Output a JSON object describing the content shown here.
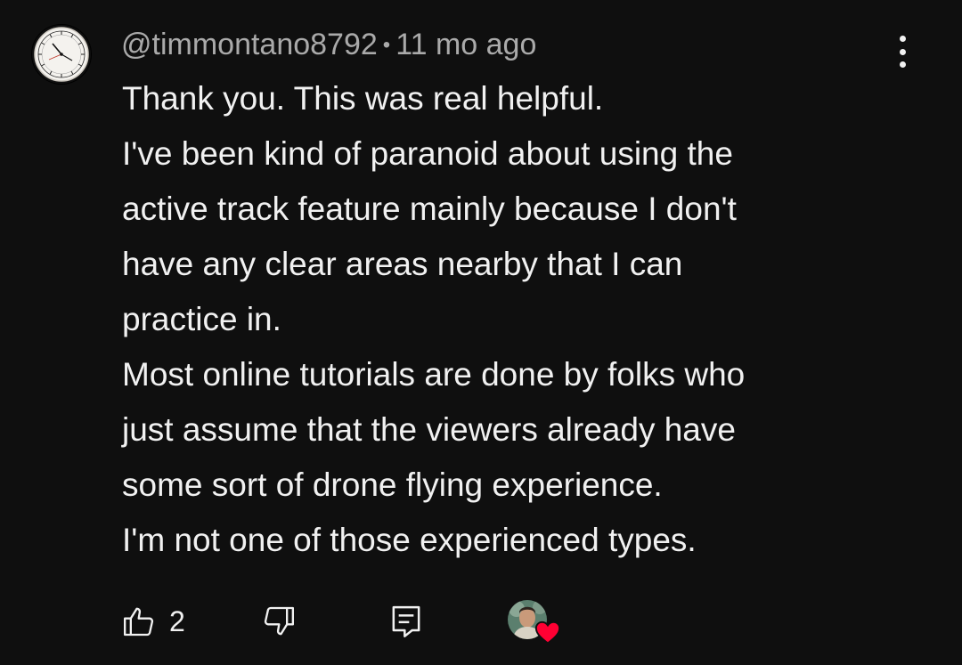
{
  "comment": {
    "username": "@timmontano8792",
    "separator": "•",
    "timestamp": "11 mo ago",
    "lines": [
      "Thank you.  This was real helpful.",
      "I've been kind of paranoid about using the",
      "active track feature mainly because I don't",
      "have any clear areas nearby that I can",
      "practice in.",
      "Most online tutorials are done by folks who",
      "just assume that the viewers already have",
      "some sort of drone flying experience.",
      "I'm not one of those experienced types."
    ],
    "like_count": "2"
  },
  "icons": {
    "avatar": "watch-face-avatar-icon",
    "menu": "more-vertical-icon",
    "like": "thumbs-up-icon",
    "dislike": "thumbs-down-icon",
    "reply": "reply-comment-icon",
    "creator_heart": "creator-heart-icon"
  },
  "colors": {
    "background": "#0f0f0f",
    "text": "#f1f1f1",
    "meta": "#aaaaaa",
    "heart": "#ff0033"
  }
}
